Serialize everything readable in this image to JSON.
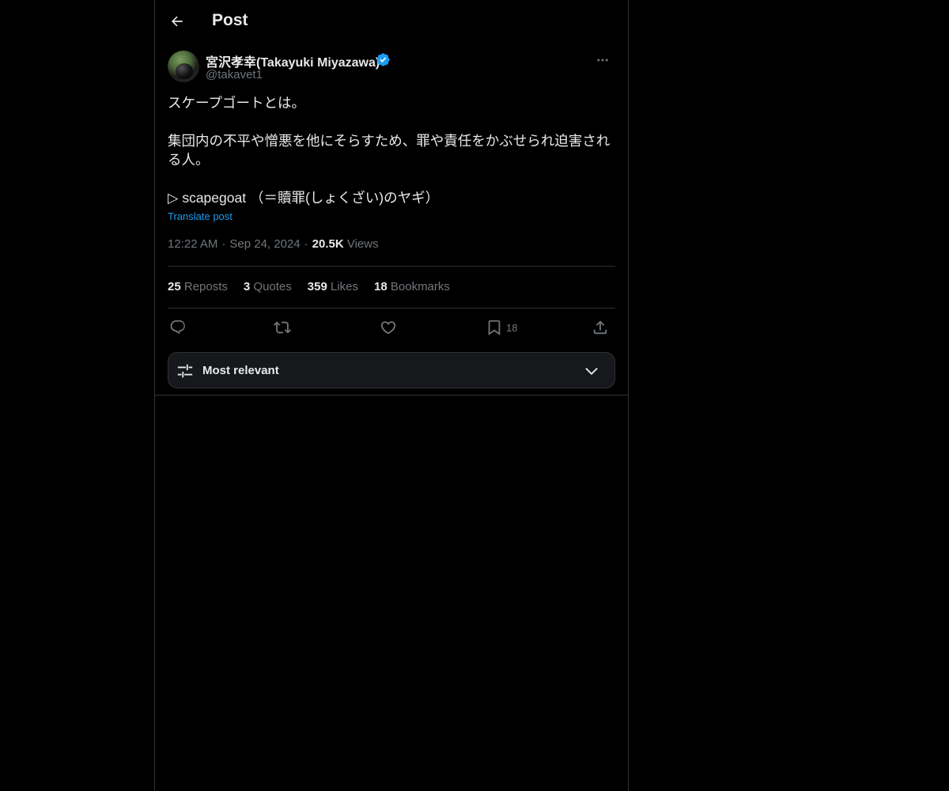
{
  "header": {
    "title": "Post"
  },
  "author": {
    "name": "宮沢孝幸(Takayuki Miyazawa)",
    "handle": "@takavet1",
    "verified_color": "#1d9bf0"
  },
  "post": {
    "text": "スケープゴートとは。\n\n集団内の不平や憎悪を他にそらすため、罪や責任をかぶせられ迫害される人。\n\n▷ scapegoat （＝贖罪(しょくざい)のヤギ）",
    "translate_label": "Translate post",
    "time": "12:22 AM",
    "date": "Sep 24, 2024",
    "views_count": "20.5K",
    "views_label": "Views"
  },
  "stats": {
    "reposts_count": "25",
    "reposts_label": "Reposts",
    "quotes_count": "3",
    "quotes_label": "Quotes",
    "likes_count": "359",
    "likes_label": "Likes",
    "bookmarks_count": "18",
    "bookmarks_label": "Bookmarks"
  },
  "actions": {
    "reply_icon": "reply-icon",
    "repost_icon": "repost-icon",
    "like_icon": "heart-icon",
    "bookmark_icon": "bookmark-icon",
    "bookmark_count": "18",
    "share_icon": "share-icon"
  },
  "sort": {
    "label": "Most relevant"
  },
  "colors": {
    "background": "#000000",
    "border": "#2f3336",
    "muted": "#71767b",
    "text": "#e7e9ea",
    "accent": "#1d9bf0"
  }
}
